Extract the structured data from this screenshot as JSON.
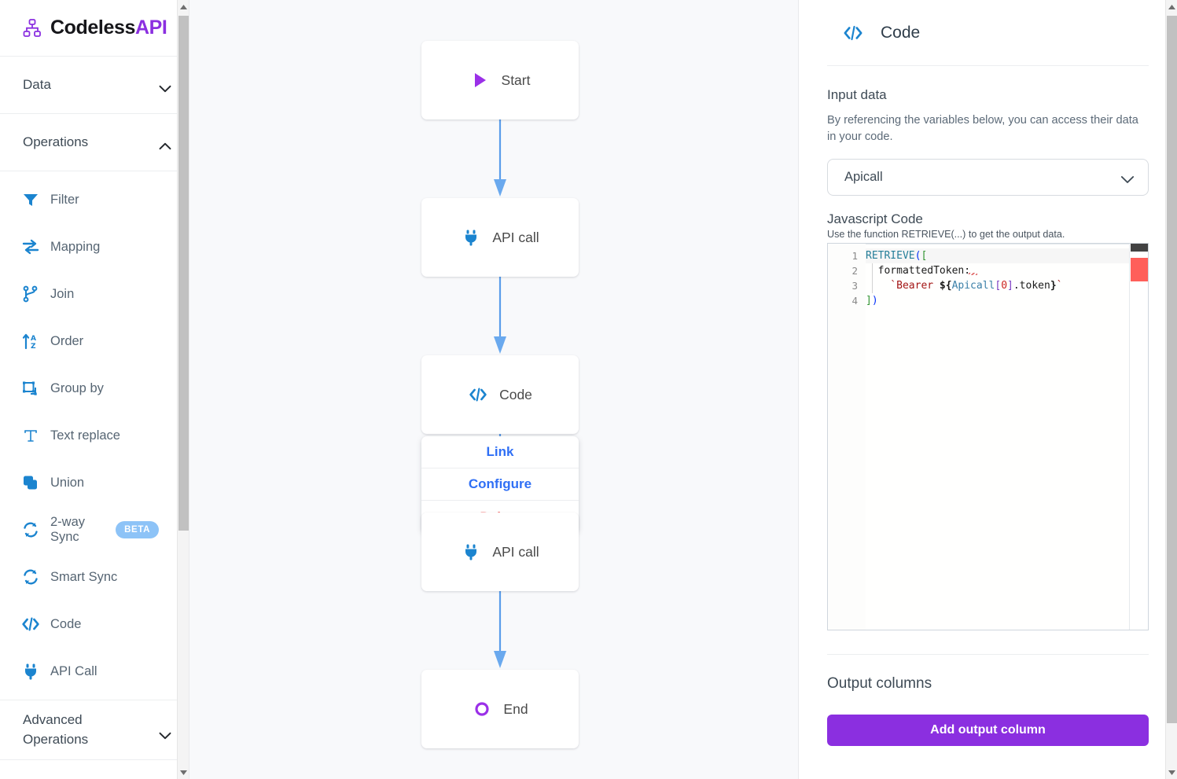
{
  "brand": {
    "name_dark": "Codeless",
    "name_accent": "API",
    "logo_icon": "sitemap-icon"
  },
  "sidebar": {
    "sections": [
      {
        "label": "Data",
        "expanded": false,
        "chevron": "chevron-down-icon"
      },
      {
        "label": "Operations",
        "expanded": true,
        "chevron": "chevron-up-icon"
      }
    ],
    "operations": [
      {
        "label": "Filter",
        "icon": "filter-icon"
      },
      {
        "label": "Mapping",
        "icon": "mapping-arrows-icon"
      },
      {
        "label": "Join",
        "icon": "join-branch-icon"
      },
      {
        "label": "Order",
        "icon": "sort-az-icon"
      },
      {
        "label": "Group by",
        "icon": "group-by-icon"
      },
      {
        "label": "Text replace",
        "icon": "text-replace-icon"
      },
      {
        "label": "Union",
        "icon": "union-squares-icon"
      },
      {
        "label": "2-way Sync",
        "icon": "sync-icon",
        "badge": "BETA"
      },
      {
        "label": "Smart Sync",
        "icon": "sync-icon"
      },
      {
        "label": "Code",
        "icon": "code-brackets-icon"
      },
      {
        "label": "API Call",
        "icon": "plug-icon"
      }
    ],
    "advanced": {
      "label": "Advanced Operations",
      "chevron": "chevron-down-icon"
    }
  },
  "canvas": {
    "nodes": [
      {
        "id": "start",
        "label": "Start",
        "icon": "play-triangle-icon"
      },
      {
        "id": "api1",
        "label": "API call",
        "icon": "plug-icon"
      },
      {
        "id": "code",
        "label": "Code",
        "icon": "code-brackets-icon"
      },
      {
        "id": "api2",
        "label": "API call",
        "icon": "plug-icon"
      },
      {
        "id": "end",
        "label": "End",
        "icon": "circle-outline-icon"
      }
    ],
    "context_menu": {
      "items": [
        {
          "label": "Link",
          "kind": "normal"
        },
        {
          "label": "Configure",
          "kind": "normal"
        },
        {
          "label": "Delete",
          "kind": "danger"
        }
      ]
    },
    "edge_color": "#5a9dea"
  },
  "panel": {
    "icon": "code-brackets-icon",
    "title": "Code",
    "input_data": {
      "heading": "Input data",
      "description": "By referencing the variables below, you can access their data in your code.",
      "select_value": "Apicall",
      "select_chevron": "chevron-down-icon"
    },
    "code_section": {
      "heading": "Javascript Code",
      "hint": "Use the function RETRIEVE(...) to get the output data.",
      "lines": [
        {
          "num": "1",
          "text": "RETRIEVE(["
        },
        {
          "num": "2",
          "text": "  formattedToken:"
        },
        {
          "num": "3",
          "text": "    `Bearer ${Apicall[0].token}`"
        },
        {
          "num": "4",
          "text": "])"
        }
      ]
    },
    "output": {
      "heading": "Output columns",
      "add_button": "Add output column"
    }
  },
  "colors": {
    "brand_purple": "#8b2fe0",
    "icon_blue": "#1b84cf",
    "link_blue": "#2f6ff5",
    "edge_blue": "#5a9dea",
    "beta_badge": "#8dc3f7",
    "error_red": "#ff5f5a"
  }
}
